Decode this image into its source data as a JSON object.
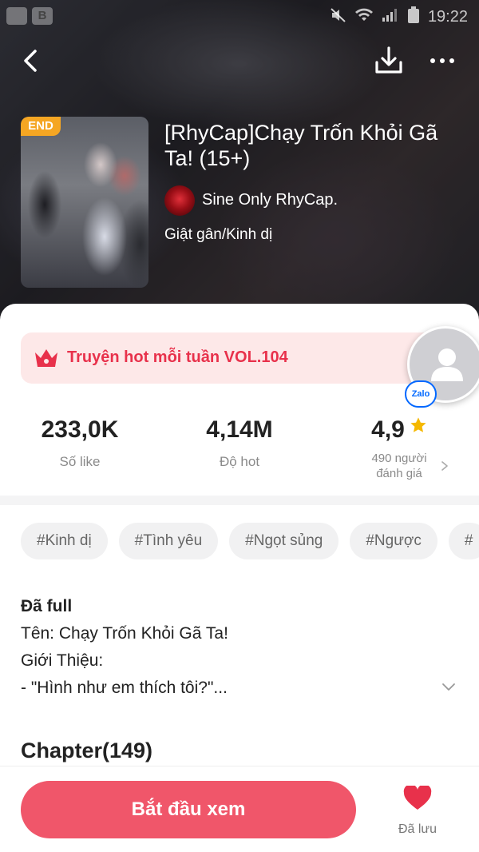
{
  "status_bar": {
    "left_badge": "B",
    "time": "19:22",
    "icons": [
      "notification-icon",
      "mute-icon",
      "wifi-icon",
      "signal-icon",
      "battery-icon"
    ]
  },
  "nav": {
    "back_icon": "back-arrow-icon",
    "download_icon": "download-icon",
    "more_icon": "more-dots-icon"
  },
  "comic": {
    "badge": "END",
    "title": "[RhyCap]Chạy Trốn Khỏi Gã Ta! (15+)",
    "author": "Sine Only RhyCap.",
    "genre": "Giật gân/Kinh dị"
  },
  "hot_banner": {
    "icon": "crown-icon",
    "text": "Truyện hot mỗi tuần VOL.104",
    "color": "#e8314b"
  },
  "floating_contact": {
    "avatar_icon": "user-avatar-icon",
    "badge": "Zalo"
  },
  "stats": {
    "likes_value": "233,0K",
    "likes_label": "Số like",
    "hot_value": "4,14M",
    "hot_label": "Độ hot",
    "rating_value": "4,9",
    "rating_label_line1": "490 người",
    "rating_label_line2": "đánh giá"
  },
  "tags": [
    "#Kinh dị",
    "#Tình yêu",
    "#Ngọt sủng",
    "#Ngược",
    "#"
  ],
  "description": {
    "status": "Đã full",
    "line1": "Tên: Chạy Trốn Khỏi Gã Ta!",
    "line2": "Giới Thiệu:",
    "line3": "- \"Hình như em thích tôi?\"..."
  },
  "chapters": {
    "title": "Chapter(149)"
  },
  "bottom": {
    "start_label": "Bắt đầu xem",
    "saved_label": "Đã lưu",
    "accent": "#f0566a"
  }
}
